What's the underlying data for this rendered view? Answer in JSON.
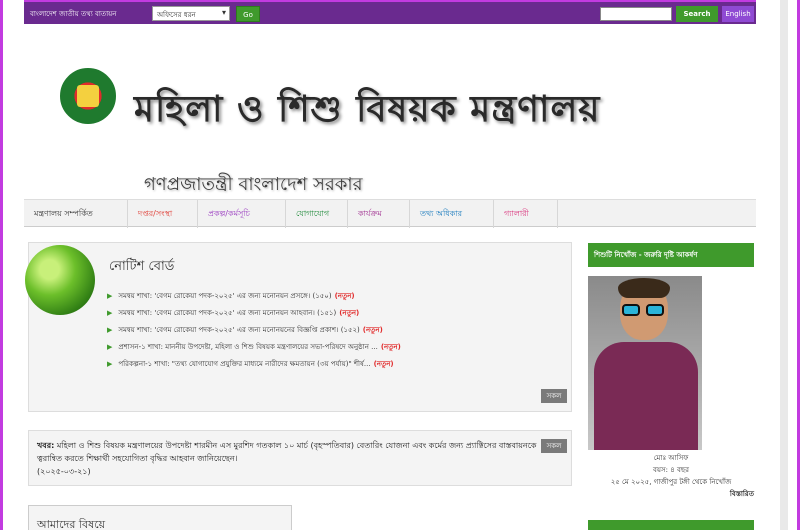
{
  "topbar": {
    "portal_text": "বাংলাদেশ জাতীয় তথ্য বাতায়ন",
    "office_select": "অফিসের ধরন",
    "go_label": "Go",
    "search_label": "Search",
    "lang_label": "English"
  },
  "header": {
    "title": "মহিলা ও শিশু বিষয়ক মন্ত্রণালয়",
    "subtitle": "গণপ্রজাতন্ত্রী বাংলাদেশ সরকার"
  },
  "nav": [
    "মন্ত্রণালয় সম্পর্কিত",
    "দপ্তর/সংস্থা",
    "প্রকল্প/কর্মসূচি",
    "যোগাযোগ",
    "কার্যক্রম",
    "তথ্য অধিকার",
    "গ্যালারী"
  ],
  "notice_board": {
    "title": "নোটিশ বোর্ড",
    "items": [
      "সমন্বয় শাখা: 'বেগম রোকেয়া পদক-২০২৫' এর জন্য মনোনয়ন প্রসঙ্গে। (১৫০)",
      "সমন্বয় শাখা: 'বেগম রোকেয়া পদক-২০২৫' এর জন্য মনোনয়ন আহবান। (১৫১)",
      "সমন্বয় শাখা: 'বেগম রোকেয়া পদক-২০২৫' এর জন্য মনোনয়নের বিজ্ঞপ্তি প্রকাশ। (১৫২)",
      "প্রশাসন-১ শাখা: মাননীয় উপদেষ্টা, মহিলা ও শিশু বিষয়ক মন্ত্রণালয়ের সভা-পরিষদে অনুষ্ঠান ...",
      "পরিকল্পনা-১ শাখা: \"তথ্য যোগাযোগ প্রযুক্তির মাধ্যমে নারীদের ক্ষমতায়ন (৩য় পর্যায়)\" শীর্ষ..."
    ],
    "new_label": "(নতুন)",
    "all_label": "সকল"
  },
  "news": {
    "prefix": "খবর:",
    "text": "মহিলা ও শিশু বিষয়ক মন্ত্রণালয়ের উপদেষ্টা শারমীন এস মুরশিদ গতকাল ১০ মার্চ (বৃহস্পতিবার) বেতারিং যোজনা এবং কর্মের জন্য প্র্যাক্টিসের বাস্তবায়নকে ত্বরান্বিত করতে শিক্ষার্থী সহযোগিতা বৃদ্ধির আহবান জানিয়েছেন।",
    "date": "(২০২৫-০৩-২১)",
    "all_label": "সকল"
  },
  "about": {
    "title": "আমাদের বিষয়ে"
  },
  "sidebar": {
    "heading": "শিশুটি নিখোঁজ - জরুরি দৃষ্টি আকর্ষণ",
    "caption_name": "মোঃ আসিফ",
    "caption_age": "বয়স: ৪ বছর",
    "caption_detail": "২৫ মে ২০২৫, গাজীপুর টঙ্গী থেকে নিখোঁজ",
    "more_label": "বিস্তারিত"
  }
}
